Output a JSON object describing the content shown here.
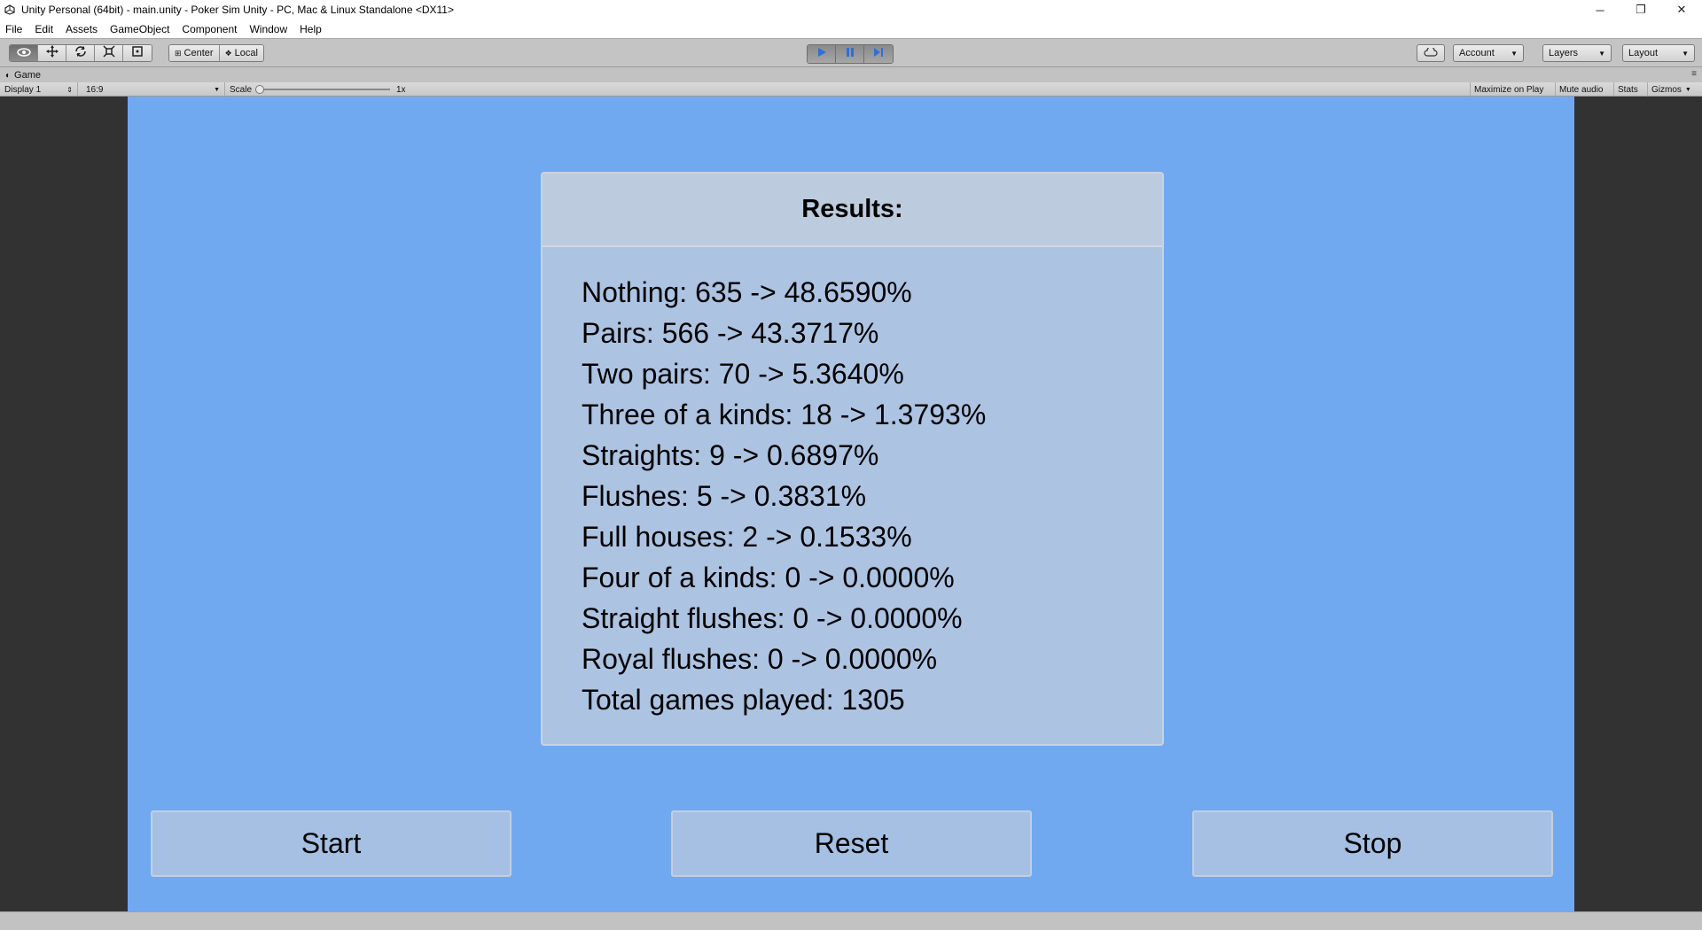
{
  "window": {
    "title": "Unity Personal (64bit) - main.unity - Poker Sim Unity - PC, Mac & Linux Standalone <DX11>",
    "controls": {
      "minimize": "─",
      "restore": "❐",
      "close": "✕"
    }
  },
  "menu": [
    "File",
    "Edit",
    "Assets",
    "GameObject",
    "Component",
    "Window",
    "Help"
  ],
  "toolbar": {
    "transform_tools": [
      "eye-icon",
      "move-icon",
      "rotate-icon",
      "scale-icon",
      "rect-icon"
    ],
    "pivot": {
      "center": "Center",
      "local": "Local"
    },
    "playback": [
      "play-icon",
      "pause-icon",
      "step-icon"
    ],
    "account": "Account",
    "layers": "Layers",
    "layout": "Layout",
    "play_color": "#2f6fd8"
  },
  "game_tab": {
    "label": "Game"
  },
  "game_view_bar": {
    "display": "Display 1",
    "aspect": "16:9",
    "scale_label": "Scale",
    "scale_value": "1x",
    "maximize": "Maximize on Play",
    "mute": "Mute audio",
    "stats": "Stats",
    "gizmos": "Gizmos"
  },
  "results": {
    "title": "Results:",
    "lines": [
      "Nothing: 635 -> 48.6590%",
      "Pairs: 566 -> 43.3717%",
      "Two pairs: 70 -> 5.3640%",
      "Three of a kinds: 18 -> 1.3793%",
      "Straights: 9 -> 0.6897%",
      "Flushes: 5 -> 0.3831%",
      "Full houses: 2 -> 0.1533%",
      "Four of a kinds: 0 -> 0.0000%",
      "Straight flushes: 0 -> 0.0000%",
      "Royal flushes: 0 -> 0.0000%",
      "Total games played: 1305"
    ]
  },
  "buttons": {
    "start": "Start",
    "reset": "Reset",
    "stop": "Stop"
  },
  "colors": {
    "canvas_bg": "#71a9f1",
    "panel_bg": "#adc3e2",
    "editor_bg": "#323232"
  }
}
